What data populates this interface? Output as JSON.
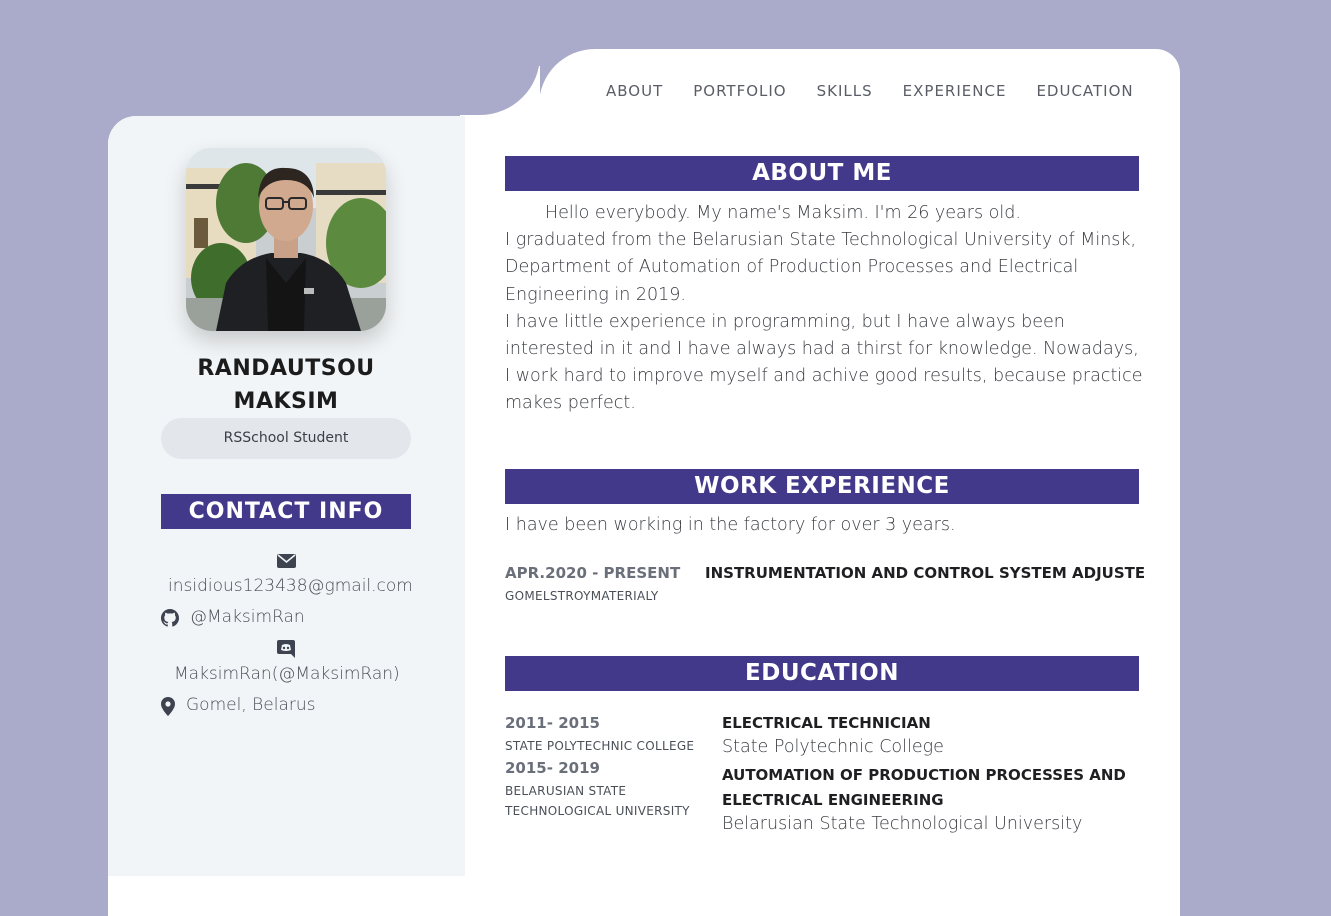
{
  "colors": {
    "background": "#aaaacb",
    "accent": "#43398a",
    "sidebar": "#f2f5f7",
    "badge": "#e3e7ec"
  },
  "nav": [
    "ABOUT",
    "PORTFOLIO",
    "SKILLS",
    "EXPERIENCE",
    "EDUCATION"
  ],
  "profile": {
    "name_line1": "RANDAUTSOU",
    "name_line2": "MAKSIM",
    "badge": "RSSchool Student"
  },
  "contact": {
    "title": "CONTACT INFO",
    "email": "insidious123438@gmail.com",
    "github": "@MaksimRan",
    "discord": "MaksimRan(@MaksimRan)",
    "location": "Gomel, Belarus",
    "icons": [
      "envelope-icon",
      "github-icon",
      "discord-icon",
      "map-pin-icon"
    ]
  },
  "about": {
    "title": "ABOUT ME",
    "intro": "Hello everybody. My name's Maksim. I'm 26 years old.",
    "education_line": "I graduated from the Belarusian State Technological University of Minsk, Department of Automation of Production Processes and Electrical Engineering in 2019.",
    "experience_line": "I have little experience in programming, but I have always been interested in it and I have always had a thirst for knowledge. Nowadays, I work hard to improve myself and achive good results, because practice makes perfect."
  },
  "work": {
    "title": "WORK EXPERIENCE",
    "summary": "I have been working in the factory for over 3 years.",
    "jobs": [
      {
        "period": "APR.2020 - PRESENT",
        "company": "GOMELSTROYMATERIALY",
        "position": "INSTRUMENTATION AND CONTROL SYSTEM ADJUSTE"
      }
    ]
  },
  "education": {
    "title": "EDUCATION",
    "periods": [
      {
        "years": "2011- 2015",
        "school_line1": "STATE POLYTECHNIC COLLEGE",
        "school_line2": ""
      },
      {
        "years": "2015- 2019",
        "school_line1": "BELARUSIAN STATE",
        "school_line2": "TECHNOLOGICAL UNIVERSITY"
      }
    ],
    "degrees": [
      {
        "degree_line1": "ELECTRICAL TECHNICIAN",
        "degree_line2": "",
        "institution": "State Polytechnic College"
      },
      {
        "degree_line1": "AUTOMATION OF PRODUCTION PROCESSES AND",
        "degree_line2": "ELECTRICAL ENGINEERING",
        "institution": "Belarusian State Technological University"
      }
    ]
  }
}
